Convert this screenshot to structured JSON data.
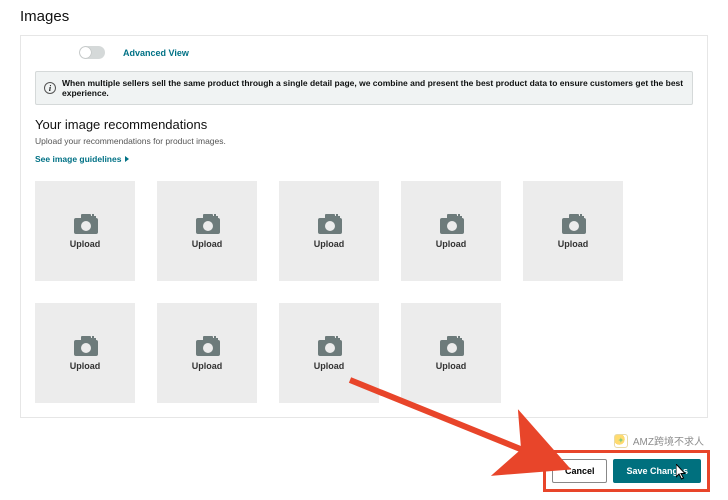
{
  "page": {
    "title": "Images"
  },
  "toggle": {
    "label": "Advanced View",
    "on": false
  },
  "info": {
    "text": "When multiple sellers sell the same product through a single detail page, we combine and present the best product data to ensure customers get the best experience."
  },
  "recs": {
    "heading": "Your image recommendations",
    "sub": "Upload your recommendations for product images.",
    "guidelines_link": "See image guidelines"
  },
  "tiles": [
    {
      "label": "Upload"
    },
    {
      "label": "Upload"
    },
    {
      "label": "Upload"
    },
    {
      "label": "Upload"
    },
    {
      "label": "Upload"
    },
    {
      "label": "Upload"
    },
    {
      "label": "Upload"
    },
    {
      "label": "Upload"
    },
    {
      "label": "Upload"
    }
  ],
  "actions": {
    "cancel": "Cancel",
    "save": "Save Changes"
  },
  "watermark": {
    "text": "AMZ跨境不求人"
  },
  "colors": {
    "teal": "#007185",
    "accent_red": "#e8452a",
    "btn_primary": "#00707e"
  }
}
